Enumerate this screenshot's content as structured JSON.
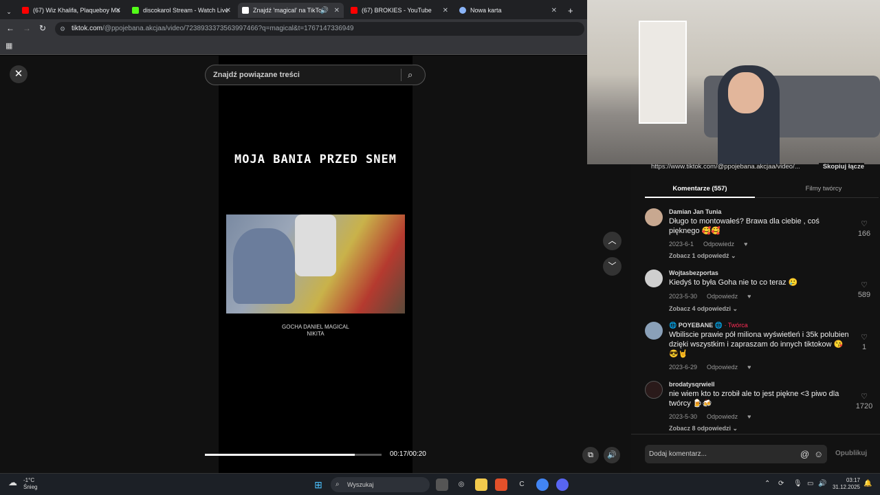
{
  "browser": {
    "tabs": [
      {
        "title": "(67) Wiz Khalifa, Plaqueboy Ma",
        "color": "#ff0000"
      },
      {
        "title": "discokarol Stream - Watch Live",
        "color": "#53fc18"
      },
      {
        "title": "Znajdź 'magical' na TikTok",
        "color": "#ffffff"
      },
      {
        "title": "(67) BROKIES - YouTube",
        "color": "#ff0000"
      },
      {
        "title": "Nowa karta",
        "color": "#8ab4f8"
      }
    ],
    "url_host": "tiktok.com",
    "url_path": "/@ppojebana.akcjaa/video/7238933373563997466?q=magical&t=1767147336949"
  },
  "player": {
    "search_placeholder": "Znajdź powiązane treści",
    "video_title": "MOJA BANIA PRZED SNEM",
    "video_caption_line1": "GOCHA DANIEL MAGICAL",
    "video_caption_line2": "NIKITA",
    "time": "00:17/00:20",
    "progress_fraction": 0.85
  },
  "side": {
    "share_link": "https://www.tiktok.com/@ppojebana.akcjaa/video/...",
    "copy_label": "Skopiuj łącze",
    "tab_comments": "Komentarze (557)",
    "tab_creator": "Filmy twórcy",
    "reply_label": "Odpowiedz",
    "comments": [
      {
        "author": "Damian Jan Tunia",
        "tag": "",
        "text": "Długo to montowałeś? Brawa dla ciebie , coś pięknego 🥰🥰",
        "date": "2023-6-1",
        "likes": "166",
        "more": "Zobacz 1 odpowiedź ⌄",
        "avatar": "#c8a890"
      },
      {
        "author": "Wojtasbezportas",
        "tag": "",
        "text": "Kiedyś to była Goha nie to co teraz 🥲",
        "date": "2023-5-30",
        "likes": "589",
        "more": "Zobacz 4 odpowiedzi ⌄",
        "avatar": "#cfcfcf"
      },
      {
        "author": "🌐 POYEBANE 🌐",
        "tag": "· Twórca",
        "text": "Wbiliscie prawie pół miliona wyświetleń i 35k polubien dzięki wszystkim i zapraszam do innych tiktokow 😘😎🤘",
        "date": "2023-6-29",
        "likes": "1",
        "more": "",
        "avatar": "#8aa0b8"
      },
      {
        "author": "brodatysqrwiell",
        "tag": "",
        "text": "nie wiem kto to zrobił ale to jest piękne <3 piwo dla twórcy 🍺🍻",
        "date": "2023-5-30",
        "likes": "1720",
        "more": "Zobacz 8 odpowiedzi ⌄",
        "avatar": "#2a1a1a"
      }
    ],
    "comment_placeholder": "Dodaj komentarz...",
    "publish_label": "Opublikuj"
  },
  "taskbar": {
    "temp": "-1°C",
    "weather": "Śnieg",
    "search": "Wyszukaj",
    "time": "03:17",
    "date": "31.12.2025"
  }
}
